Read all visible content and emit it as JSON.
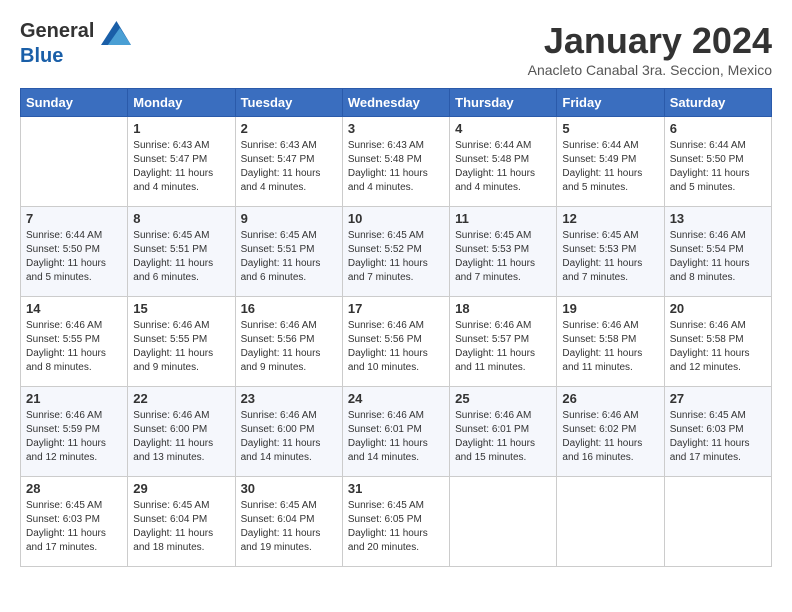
{
  "header": {
    "logo_text1": "General",
    "logo_text2": "Blue",
    "title": "January 2024",
    "subtitle": "Anacleto Canabal 3ra. Seccion, Mexico"
  },
  "days_of_week": [
    "Sunday",
    "Monday",
    "Tuesday",
    "Wednesday",
    "Thursday",
    "Friday",
    "Saturday"
  ],
  "weeks": [
    [
      {
        "day": "",
        "sunrise": "",
        "sunset": "",
        "daylight": ""
      },
      {
        "day": "1",
        "sunrise": "Sunrise: 6:43 AM",
        "sunset": "Sunset: 5:47 PM",
        "daylight": "Daylight: 11 hours and 4 minutes."
      },
      {
        "day": "2",
        "sunrise": "Sunrise: 6:43 AM",
        "sunset": "Sunset: 5:47 PM",
        "daylight": "Daylight: 11 hours and 4 minutes."
      },
      {
        "day": "3",
        "sunrise": "Sunrise: 6:43 AM",
        "sunset": "Sunset: 5:48 PM",
        "daylight": "Daylight: 11 hours and 4 minutes."
      },
      {
        "day": "4",
        "sunrise": "Sunrise: 6:44 AM",
        "sunset": "Sunset: 5:48 PM",
        "daylight": "Daylight: 11 hours and 4 minutes."
      },
      {
        "day": "5",
        "sunrise": "Sunrise: 6:44 AM",
        "sunset": "Sunset: 5:49 PM",
        "daylight": "Daylight: 11 hours and 5 minutes."
      },
      {
        "day": "6",
        "sunrise": "Sunrise: 6:44 AM",
        "sunset": "Sunset: 5:50 PM",
        "daylight": "Daylight: 11 hours and 5 minutes."
      }
    ],
    [
      {
        "day": "7",
        "sunrise": "Sunrise: 6:44 AM",
        "sunset": "Sunset: 5:50 PM",
        "daylight": "Daylight: 11 hours and 5 minutes."
      },
      {
        "day": "8",
        "sunrise": "Sunrise: 6:45 AM",
        "sunset": "Sunset: 5:51 PM",
        "daylight": "Daylight: 11 hours and 6 minutes."
      },
      {
        "day": "9",
        "sunrise": "Sunrise: 6:45 AM",
        "sunset": "Sunset: 5:51 PM",
        "daylight": "Daylight: 11 hours and 6 minutes."
      },
      {
        "day": "10",
        "sunrise": "Sunrise: 6:45 AM",
        "sunset": "Sunset: 5:52 PM",
        "daylight": "Daylight: 11 hours and 7 minutes."
      },
      {
        "day": "11",
        "sunrise": "Sunrise: 6:45 AM",
        "sunset": "Sunset: 5:53 PM",
        "daylight": "Daylight: 11 hours and 7 minutes."
      },
      {
        "day": "12",
        "sunrise": "Sunrise: 6:45 AM",
        "sunset": "Sunset: 5:53 PM",
        "daylight": "Daylight: 11 hours and 7 minutes."
      },
      {
        "day": "13",
        "sunrise": "Sunrise: 6:46 AM",
        "sunset": "Sunset: 5:54 PM",
        "daylight": "Daylight: 11 hours and 8 minutes."
      }
    ],
    [
      {
        "day": "14",
        "sunrise": "Sunrise: 6:46 AM",
        "sunset": "Sunset: 5:55 PM",
        "daylight": "Daylight: 11 hours and 8 minutes."
      },
      {
        "day": "15",
        "sunrise": "Sunrise: 6:46 AM",
        "sunset": "Sunset: 5:55 PM",
        "daylight": "Daylight: 11 hours and 9 minutes."
      },
      {
        "day": "16",
        "sunrise": "Sunrise: 6:46 AM",
        "sunset": "Sunset: 5:56 PM",
        "daylight": "Daylight: 11 hours and 9 minutes."
      },
      {
        "day": "17",
        "sunrise": "Sunrise: 6:46 AM",
        "sunset": "Sunset: 5:56 PM",
        "daylight": "Daylight: 11 hours and 10 minutes."
      },
      {
        "day": "18",
        "sunrise": "Sunrise: 6:46 AM",
        "sunset": "Sunset: 5:57 PM",
        "daylight": "Daylight: 11 hours and 11 minutes."
      },
      {
        "day": "19",
        "sunrise": "Sunrise: 6:46 AM",
        "sunset": "Sunset: 5:58 PM",
        "daylight": "Daylight: 11 hours and 11 minutes."
      },
      {
        "day": "20",
        "sunrise": "Sunrise: 6:46 AM",
        "sunset": "Sunset: 5:58 PM",
        "daylight": "Daylight: 11 hours and 12 minutes."
      }
    ],
    [
      {
        "day": "21",
        "sunrise": "Sunrise: 6:46 AM",
        "sunset": "Sunset: 5:59 PM",
        "daylight": "Daylight: 11 hours and 12 minutes."
      },
      {
        "day": "22",
        "sunrise": "Sunrise: 6:46 AM",
        "sunset": "Sunset: 6:00 PM",
        "daylight": "Daylight: 11 hours and 13 minutes."
      },
      {
        "day": "23",
        "sunrise": "Sunrise: 6:46 AM",
        "sunset": "Sunset: 6:00 PM",
        "daylight": "Daylight: 11 hours and 14 minutes."
      },
      {
        "day": "24",
        "sunrise": "Sunrise: 6:46 AM",
        "sunset": "Sunset: 6:01 PM",
        "daylight": "Daylight: 11 hours and 14 minutes."
      },
      {
        "day": "25",
        "sunrise": "Sunrise: 6:46 AM",
        "sunset": "Sunset: 6:01 PM",
        "daylight": "Daylight: 11 hours and 15 minutes."
      },
      {
        "day": "26",
        "sunrise": "Sunrise: 6:46 AM",
        "sunset": "Sunset: 6:02 PM",
        "daylight": "Daylight: 11 hours and 16 minutes."
      },
      {
        "day": "27",
        "sunrise": "Sunrise: 6:45 AM",
        "sunset": "Sunset: 6:03 PM",
        "daylight": "Daylight: 11 hours and 17 minutes."
      }
    ],
    [
      {
        "day": "28",
        "sunrise": "Sunrise: 6:45 AM",
        "sunset": "Sunset: 6:03 PM",
        "daylight": "Daylight: 11 hours and 17 minutes."
      },
      {
        "day": "29",
        "sunrise": "Sunrise: 6:45 AM",
        "sunset": "Sunset: 6:04 PM",
        "daylight": "Daylight: 11 hours and 18 minutes."
      },
      {
        "day": "30",
        "sunrise": "Sunrise: 6:45 AM",
        "sunset": "Sunset: 6:04 PM",
        "daylight": "Daylight: 11 hours and 19 minutes."
      },
      {
        "day": "31",
        "sunrise": "Sunrise: 6:45 AM",
        "sunset": "Sunset: 6:05 PM",
        "daylight": "Daylight: 11 hours and 20 minutes."
      },
      {
        "day": "",
        "sunrise": "",
        "sunset": "",
        "daylight": ""
      },
      {
        "day": "",
        "sunrise": "",
        "sunset": "",
        "daylight": ""
      },
      {
        "day": "",
        "sunrise": "",
        "sunset": "",
        "daylight": ""
      }
    ]
  ]
}
